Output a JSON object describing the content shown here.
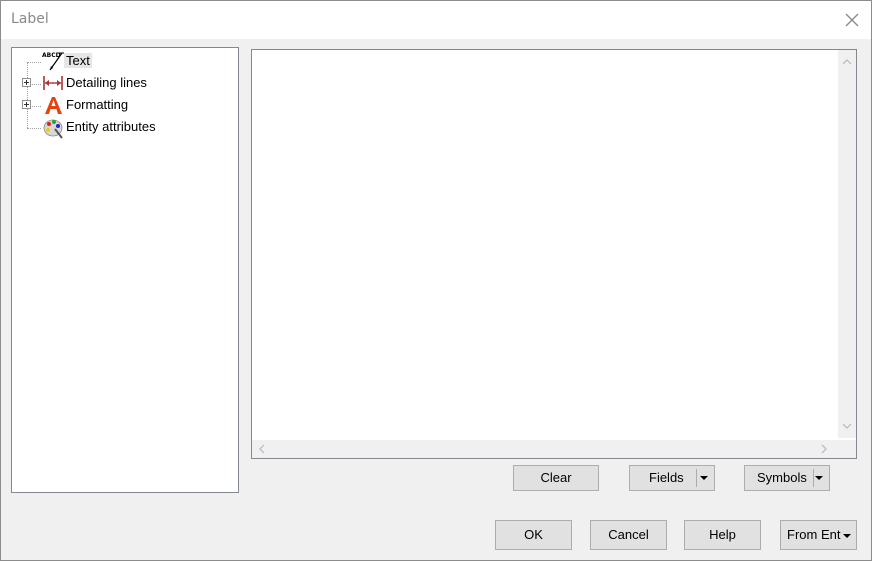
{
  "window": {
    "title": "Label"
  },
  "tree": {
    "items": [
      {
        "label": "Text",
        "icon": "text-abcd-icon",
        "expandable": false,
        "selected": true
      },
      {
        "label": "Detailing lines",
        "icon": "dimension-line-icon",
        "expandable": true
      },
      {
        "label": "Formatting",
        "icon": "formatting-a-icon",
        "expandable": true
      },
      {
        "label": "Entity attributes",
        "icon": "palette-icon",
        "expandable": false
      }
    ]
  },
  "editor": {
    "value": ""
  },
  "buttons": {
    "clear": "Clear",
    "fields": "Fields",
    "symbols": "Symbols",
    "ok": "OK",
    "cancel": "Cancel",
    "help": "Help",
    "from_ent": "From Ent"
  }
}
